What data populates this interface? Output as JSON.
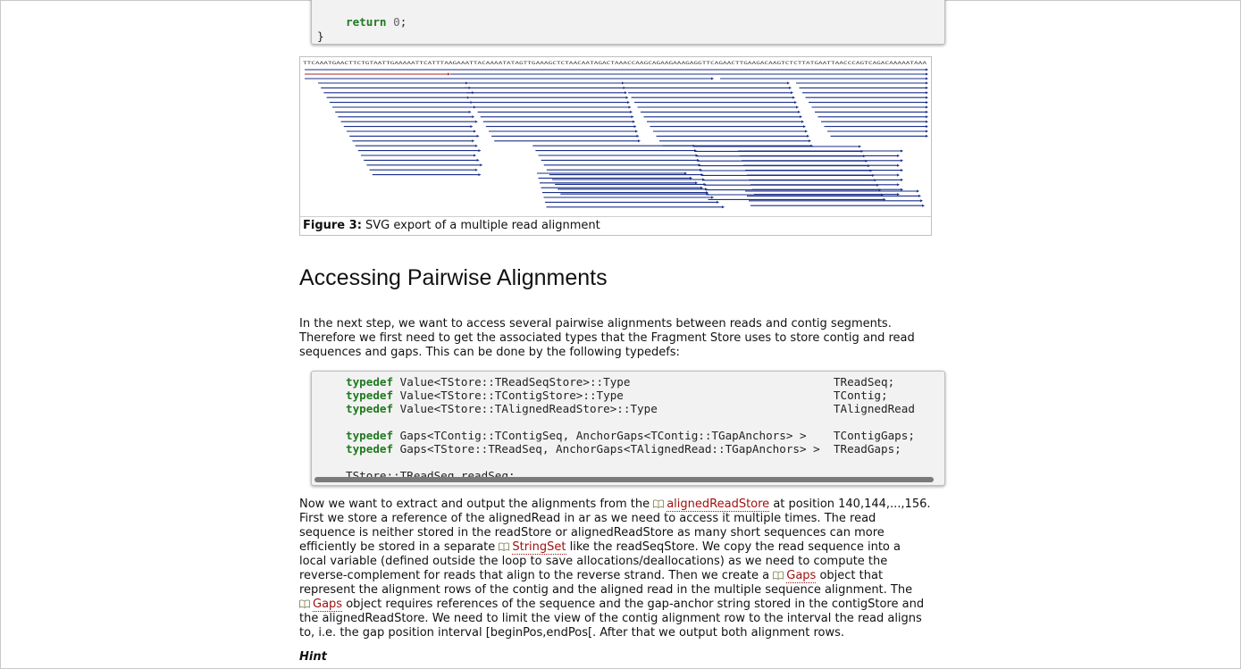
{
  "top_code": {
    "lines": [
      {
        "kw": "return",
        "rest": " ",
        "num": "0",
        "tail": ";"
      },
      {
        "kw": "",
        "rest": "}",
        "num": "",
        "tail": ""
      }
    ]
  },
  "figure": {
    "sequence_text": "TTCAAATGAACTTCTGTAATTGAAAAATTCATTTAAGAAATTACAAAATATAGTTGAAAGCTCTAACAATAGACTAAACCAAGCAGAAGAAAGAGGTTCAGAACTTGAAGACAAGTCTCTTATGAATTAACCCAGTCAGACAAAAATAAA",
    "caption_label": "Figure 3:",
    "caption_text": " SVG export of a multiple read alignment"
  },
  "section_title": "Accessing Pairwise Alignments",
  "intro_paragraph": [
    "In the next step, we want to access several pairwise alignments between reads and contig segments.",
    "Therefore we first need to get the associated types that the Fragment Store uses to store contig and read",
    "sequences and gaps. This can be done by the following typedefs:"
  ],
  "code_block": {
    "lines": [
      {
        "kw": "typedef",
        "code": " Value<TStore::TReadSeqStore>::Type                              TReadSeq;"
      },
      {
        "kw": "typedef",
        "code": " Value<TStore::TContigStore>::Type                               TContig;"
      },
      {
        "kw": "typedef",
        "code": " Value<TStore::TAlignedReadStore>::Type                          TAlignedRead"
      },
      {
        "kw": "",
        "code": ""
      },
      {
        "kw": "typedef",
        "code": " Gaps<TContig::TContigSeq, AnchorGaps<TContig::TGapAnchors> >    TContigGaps;"
      },
      {
        "kw": "typedef",
        "code": " Gaps<TStore::TReadSeq, AnchorGaps<TAlignedRead::TGapAnchors> >  TReadGaps;"
      },
      {
        "kw": "",
        "code": ""
      },
      {
        "kw": "",
        "code": "TStore::TReadSeq readSeq;"
      }
    ]
  },
  "body_paragraph": {
    "l1a": "Now we want to extract and output the alignments from the ",
    "l1_link": "alignedReadStore",
    "l1b": " at position 140,144,...,156.",
    "l2": "First we store a reference of the alignedRead in ar as we need to access it multiple times. The read",
    "l3": "sequence is neither stored in the readStore or alignedReadStore as many short sequences can more",
    "l4a": "efficiently be stored in a separate ",
    "l4_link": "StringSet",
    "l4b": " like the readSeqStore. We copy the read sequence into a",
    "l5": "local variable (defined outside the loop to save allocations/deallocations) as we need to compute the",
    "l6a": "reverse-complement for reads that align to the reverse strand. Then we create a ",
    "l6_link": "Gaps",
    "l6b": " object that",
    "l7": "represent the alignment rows of the contig and the aligned read in the multiple sequence alignment. The",
    "l8_link": "Gaps",
    "l8b": " object requires references of the sequence and the gap-anchor string stored in the contigStore and",
    "l9": "the alignedReadStore. We need to limit the view of the contig alignment row to the interval the read aligns",
    "l10": "to, i.e. the gap position interval [beginPos,endPos[. After that we output both alignment rows."
  },
  "hint_label": "Hint",
  "colors": {
    "keyword": "#1f7a1f",
    "link": "#a01010",
    "read_line": "#1a2f8a",
    "red_line": "#b22222"
  }
}
